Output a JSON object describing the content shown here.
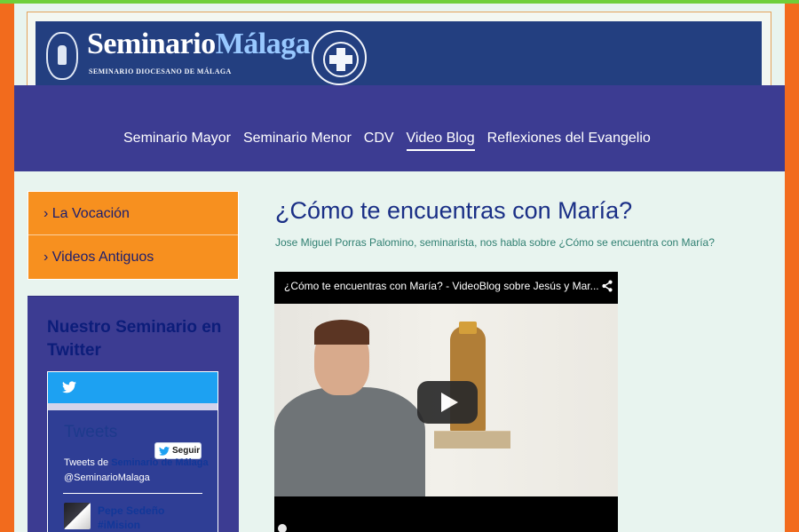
{
  "header": {
    "brand_main": "Seminario",
    "brand_accent": "Málaga",
    "brand_subtitle": "SEMINARIO DIOCESANO DE MÁLAGA"
  },
  "nav": {
    "items": [
      {
        "label": "Seminario Mayor"
      },
      {
        "label": "Seminario Menor"
      },
      {
        "label": "CDV"
      },
      {
        "label": "Video Blog"
      },
      {
        "label": "Reflexiones del Evangelio"
      }
    ],
    "active": "Video Blog"
  },
  "sidebar": {
    "menu": [
      {
        "label": "› La Vocación"
      },
      {
        "label": "› Videos Antiguos"
      }
    ],
    "twitter": {
      "heading": "Nuestro Seminario en Twitter",
      "tweets_title": "Tweets",
      "by_prefix": "Tweets de",
      "owner_name": "Seminario de Málaga",
      "handle": "@SeminarioMalaga",
      "follow_label": "Seguir",
      "tweet_author": "Pepe Sedeño",
      "tweet_snippet": "#iMision"
    }
  },
  "post": {
    "title": "¿Cómo te encuentras con María?",
    "intro": "Jose Miguel Porras Palomino, seminarista, nos habla sobre ¿Cómo se encuentra con María?",
    "video_title": "¿Cómo te encuentras con María? - VideoBlog sobre Jesús y Mar..."
  },
  "colors": {
    "accent_orange": "#f7901f",
    "nav_blue": "#3c3c92",
    "banner_blue": "#233f80",
    "twitter_blue": "#1da1f2",
    "page_bg": "#e8f4ef"
  },
  "icons": {
    "twitter": "twitter-bird-icon",
    "share": "share-icon",
    "play": "play-icon"
  }
}
